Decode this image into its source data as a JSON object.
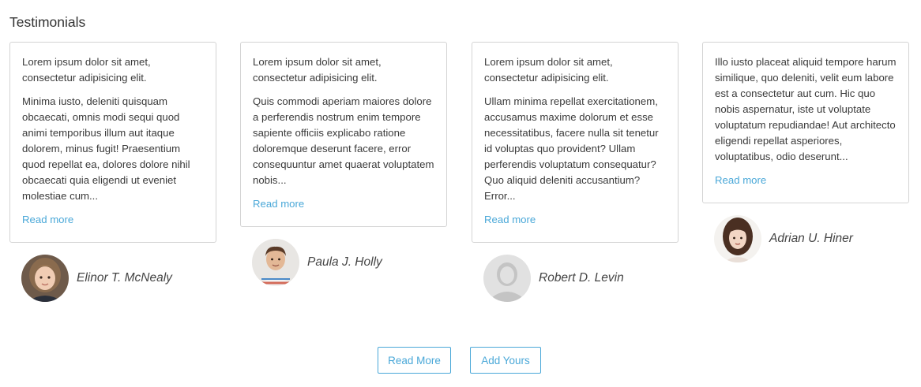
{
  "section": {
    "title": "Testimonials"
  },
  "testimonials": [
    {
      "intro": "Lorem ipsum dolor sit amet, consectetur adipisicing elit.",
      "body": "Minima iusto, deleniti quisquam obcaecati, omnis modi sequi quod animi temporibus illum aut itaque dolorem, minus fugit! Praesentium quod repellat ea, dolores dolore nihil obcaecati quia eligendi ut eveniet molestiae cum...",
      "link": "Read more",
      "author": "Elinor T. McNealy",
      "avatar_icon": "girl-portrait-icon"
    },
    {
      "intro": "Lorem ipsum dolor sit amet, consectetur adipisicing elit.",
      "body": "Quis commodi aperiam maiores dolore a perferendis nostrum enim tempore sapiente officiis explicabo ratione doloremque deserunt facere, error consequuntur amet quaerat voluptatem nobis...",
      "link": "Read more",
      "author": "Paula J. Holly",
      "avatar_icon": "man-portrait-icon"
    },
    {
      "intro": "Lorem ipsum dolor sit amet, consectetur adipisicing elit.",
      "body": "Ullam minima repellat exercitationem, accusamus maxime dolorum et esse necessitatibus, facere nulla sit tenetur id voluptas quo provident? Ullam perferendis voluptatum consequatur? Quo aliquid deleniti accusantium? Error...",
      "link": "Read more",
      "author": "Robert D. Levin",
      "avatar_icon": "default-user-icon"
    },
    {
      "intro": "",
      "body": "Illo iusto placeat aliquid tempore harum similique, quo deleniti, velit eum labore est a consectetur aut cum. Hic quo nobis aspernatur, iste ut voluptate voluptatum repudiandae! Aut architecto eligendi repellat asperiores, voluptatibus, odio deserunt...",
      "link": "Read more",
      "author": "Adrian U. Hiner",
      "avatar_icon": "woman-portrait-icon"
    }
  ],
  "buttons": {
    "read_more": "Read More",
    "add_yours": "Add Yours"
  },
  "colors": {
    "accent": "#4aa8d8",
    "border": "#d4d4d4",
    "text": "#333333"
  }
}
